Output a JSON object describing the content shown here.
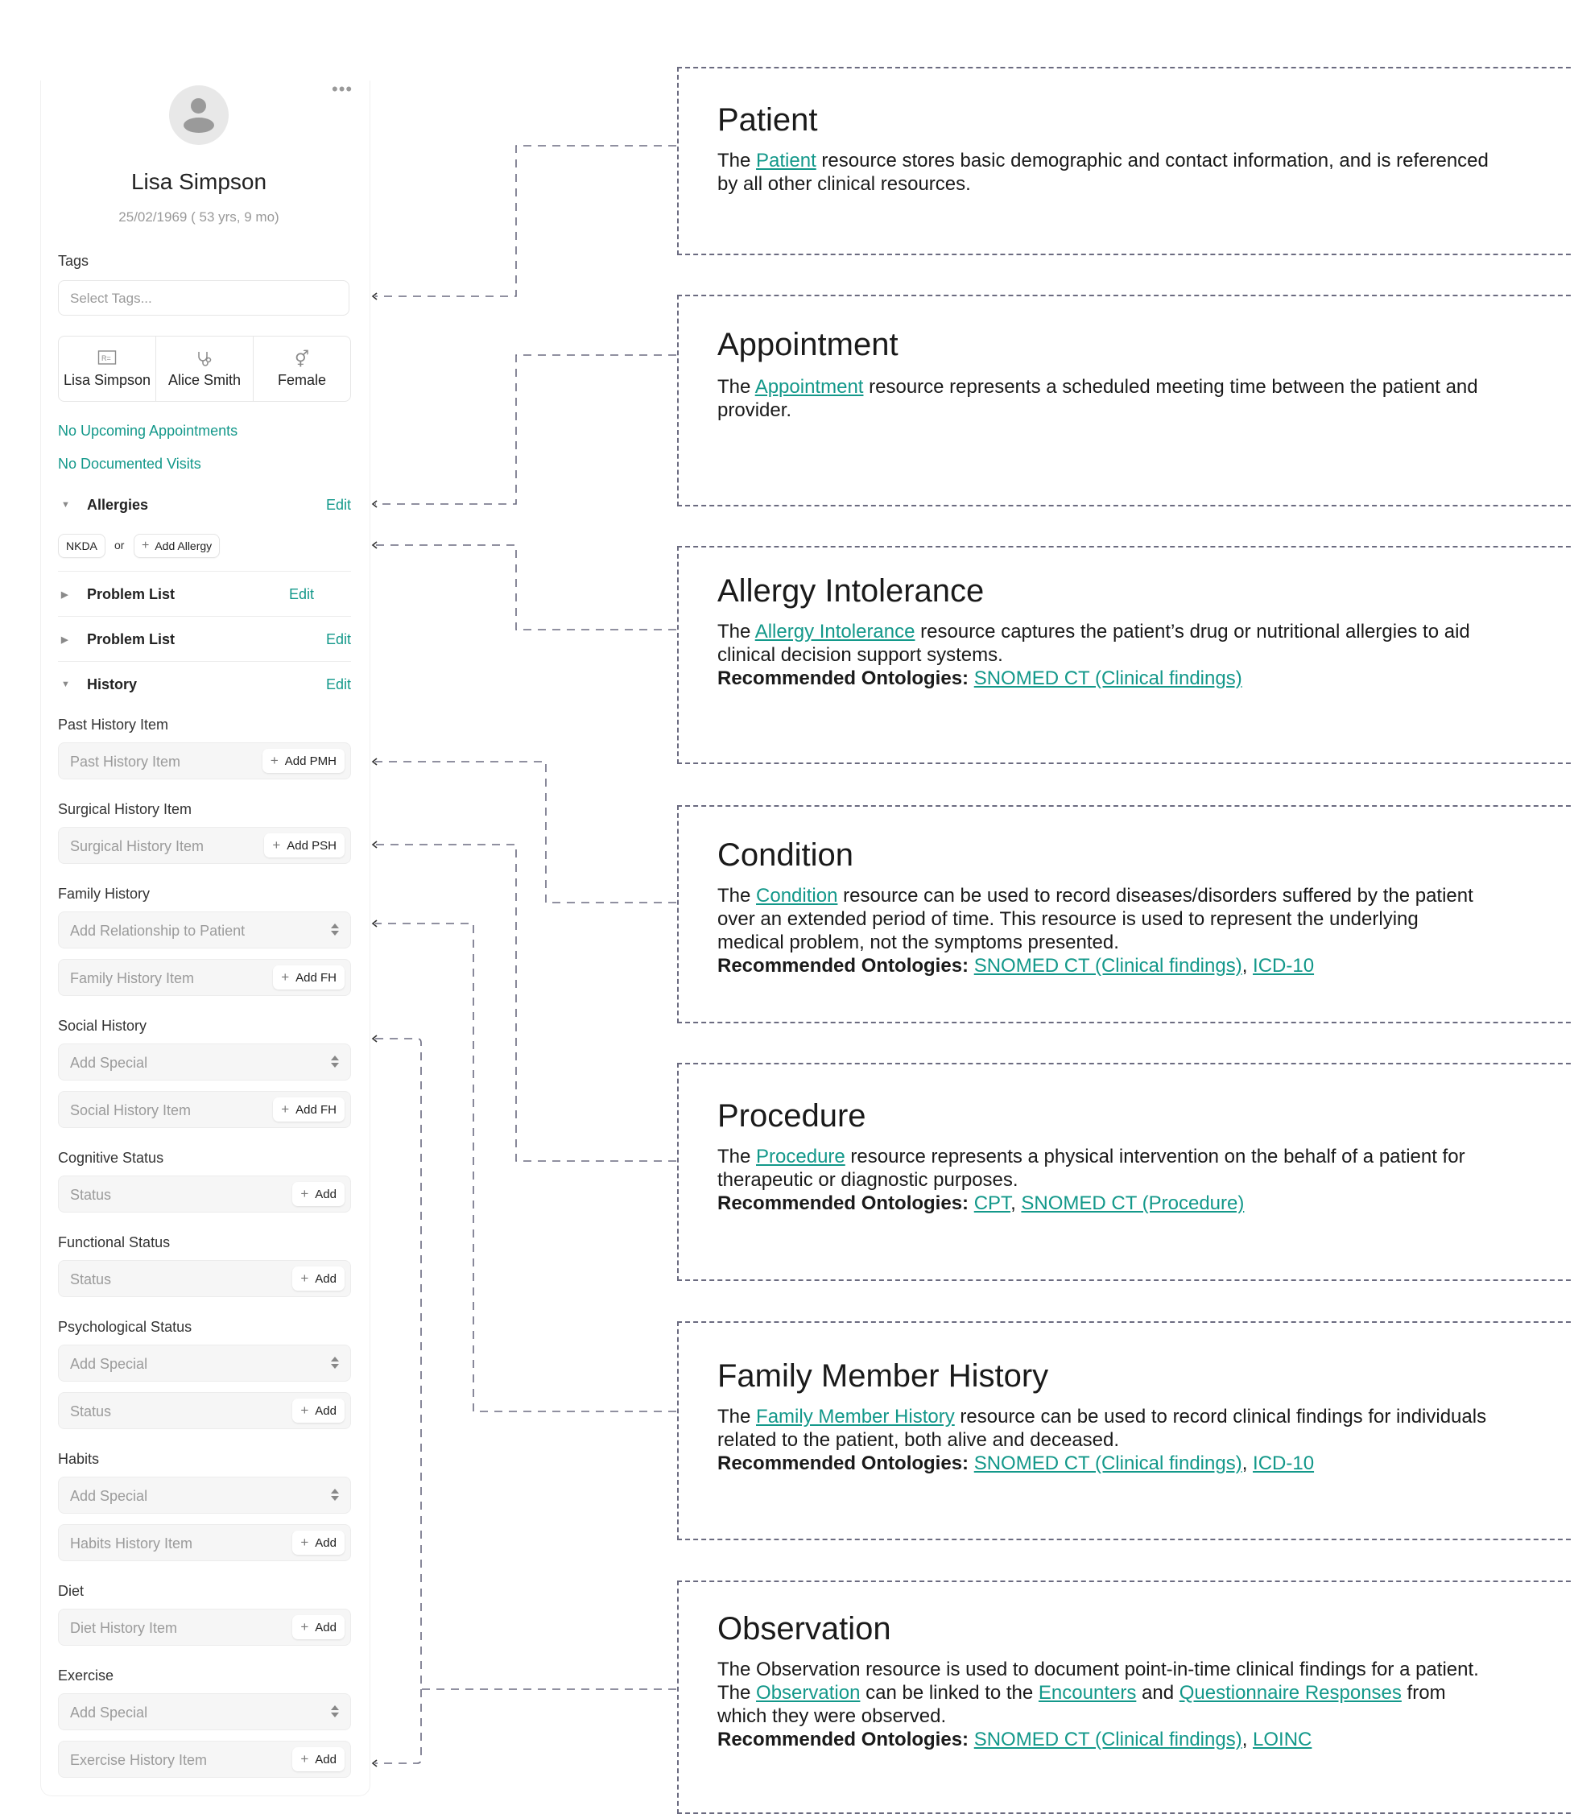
{
  "patient_panel": {
    "more_icon": "ellipsis-icon",
    "avatar_icon": "user-silhouette-icon",
    "name": "Lisa Simpson",
    "dob": "25/02/1969 ( 53 yrs, 9 mo)",
    "tags_label": "Tags",
    "tags_placeholder": "Select Tags...",
    "info": [
      {
        "icon": "id-card-icon",
        "label": "Lisa Simpson"
      },
      {
        "icon": "stethoscope-icon",
        "label": "Alice Smith"
      },
      {
        "icon": "gender-icon",
        "label": "Female"
      }
    ],
    "upcoming_appointments": "No Upcoming Appointments",
    "documented_visits": "No Documented Visits",
    "sections": {
      "allergies": {
        "title": "Allergies",
        "edit": "Edit",
        "expanded": true
      },
      "problem_list_1": {
        "title": "Problem List",
        "edit": "Edit",
        "expanded": false
      },
      "problem_list_2": {
        "title": "Problem List",
        "edit": "Edit",
        "expanded": false
      },
      "history": {
        "title": "History",
        "edit": "Edit",
        "expanded": true
      }
    },
    "allergy_row": {
      "nkda": "NKDA",
      "or": "or",
      "add_allergy": "Add Allergy"
    },
    "history_fields": {
      "past_label": "Past History Item",
      "past_placeholder": "Past History Item",
      "past_button": "Add PMH",
      "surgical_label": "Surgical History Item",
      "surgical_placeholder": "Surgical History Item",
      "surgical_button": "Add PSH",
      "family_label": "Family History",
      "family_select": "Add Relationship to Patient",
      "family_placeholder": "Family History Item",
      "family_button": "Add FH",
      "social_label": "Social History",
      "social_select": "Add Special",
      "social_placeholder": "Social History Item",
      "social_button": "Add FH",
      "cognitive_label": "Cognitive Status",
      "cognitive_placeholder": "Status",
      "cognitive_button": "Add",
      "functional_label": "Functional Status",
      "functional_placeholder": "Status",
      "functional_button": "Add",
      "psych_label": "Psychological Status",
      "psych_select": "Add Special",
      "psych_placeholder": "Status",
      "psych_button": "Add",
      "habits_label": "Habits",
      "habits_select": "Add Special",
      "habits_placeholder": "Habits History Item",
      "habits_button": "Add",
      "diet_label": "Diet",
      "diet_placeholder": "Diet History Item",
      "diet_button": "Add",
      "exercise_label": "Exercise",
      "exercise_select": "Add Special",
      "exercise_placeholder": "Exercise History Item",
      "exercise_button": "Add"
    }
  },
  "cards": {
    "patient": {
      "title": "Patient",
      "pre": "The ",
      "link": "Patient",
      "post": " resource stores basic demographic and contact information, and is referenced by all other clinical resources."
    },
    "appointment": {
      "title": "Appointment",
      "pre": "The ",
      "link": "Appointment",
      "post": " resource represents a scheduled meeting time between the patient and provider."
    },
    "allergy": {
      "title": "Allergy Intolerance",
      "pre": "The ",
      "link": "Allergy Intolerance",
      "post": " resource captures the patient’s drug or nutritional allergies to aid clinical decision support systems.",
      "ontologies_label": "Recommended Ontologies:",
      "ontologies": [
        "SNOMED CT (Clinical findings)"
      ]
    },
    "condition": {
      "title": "Condition",
      "pre": "The ",
      "link": "Condition",
      "post": " resource can be used to record diseases/disorders suffered by the patient over an extended period of time. This resource is used to represent the underlying medical problem, not the symptoms presented.",
      "ontologies_label": "Recommended Ontologies:",
      "ontologies": [
        "SNOMED CT (Clinical findings)",
        "ICD-10"
      ]
    },
    "procedure": {
      "title": "Procedure",
      "pre": "The ",
      "link": "Procedure",
      "post": " resource represents a physical intervention on the behalf of a patient for therapeutic or diagnostic purposes.",
      "ontologies_label": "Recommended Ontologies:",
      "ontologies": [
        "CPT",
        "SNOMED CT (Procedure)"
      ]
    },
    "family": {
      "title": "Family Member History",
      "pre": "The ",
      "link": "Family Member History",
      "post": " resource can be used to record clinical findings for individuals related to the patient, both alive and deceased.",
      "ontologies_label": "Recommended Ontologies:",
      "ontologies": [
        "SNOMED CT (Clinical findings)",
        "ICD-10"
      ]
    },
    "observation": {
      "title": "Observation",
      "pre": "The Observation resource is used to document point-in-time clinical findings for a patient. The ",
      "link": "Observation",
      "mid1": " can be linked to the ",
      "link2": "Encounters",
      "mid2": " and ",
      "link3": "Questionnaire Responses",
      "post": " from which they were observed.",
      "ontologies_label": "Recommended Ontologies:",
      "ontologies": [
        "SNOMED CT (Clinical findings)",
        "LOINC"
      ]
    }
  },
  "colors": {
    "accent": "#13988a",
    "connector": "#6b6b80"
  }
}
